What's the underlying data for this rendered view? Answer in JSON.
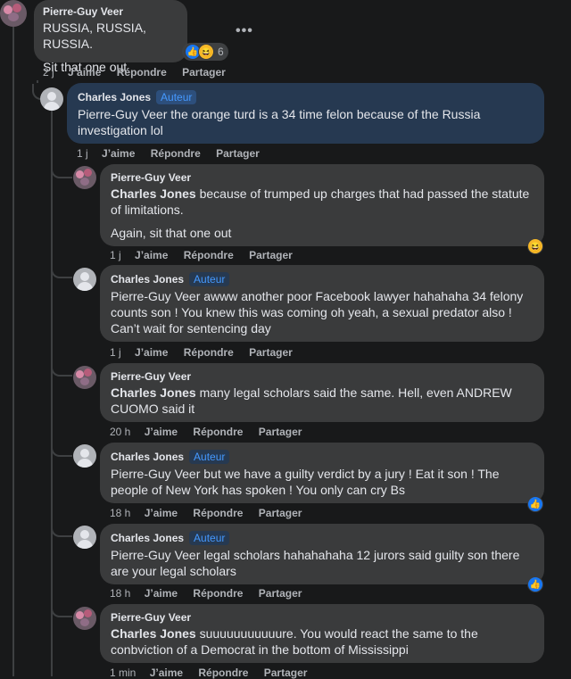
{
  "top_comment": {
    "author": "Pierre-Guy Veer",
    "line1": "RUSSIA, RUSSIA, RUSSIA.",
    "line2": "Sit that one out",
    "reaction_count": "6",
    "time": "2 j"
  },
  "actions": {
    "like": "J’aime",
    "reply": "Répondre",
    "share": "Partager"
  },
  "badge": "Auteur",
  "more_icon": "•••",
  "replies": [
    {
      "author": "Charles Jones",
      "text": "Pierre-Guy Veer the orange turd is a 34 time felon because of the Russia investigation lol",
      "time": "1 j"
    },
    {
      "author": "Pierre-Guy Veer",
      "mention": "Charles Jones",
      "text": " because of trumped up charges that had passed the statute of limitations.",
      "text2": "Again, sit that one out",
      "time": "1 j"
    },
    {
      "author": "Charles Jones",
      "text": "Pierre-Guy Veer awww another poor Facebook lawyer hahahaha 34 felony counts son ! You knew this was coming oh yeah, a sexual predator also ! Can’t wait for sentencing day",
      "time": "1 j"
    },
    {
      "author": "Pierre-Guy Veer",
      "mention": "Charles Jones",
      "text": " many legal scholars said the same. Hell, even ANDREW CUOMO said it",
      "time": "20 h"
    },
    {
      "author": "Charles Jones",
      "text": "Pierre-Guy Veer but we have a guilty verdict by a jury ! Eat it son ! The people of New York has spoken ! You only can cry Bs",
      "time": "18 h"
    },
    {
      "author": "Charles Jones",
      "text": "Pierre-Guy Veer legal scholars hahahahaha 12 jurors said guilty son there are your legal scholars",
      "time": "18 h"
    },
    {
      "author": "Pierre-Guy Veer",
      "mention": "Charles Jones",
      "text": " suuuuuuuuuuure. You would react the same to the conbviction of a Democrat in the bottom of Mississippi",
      "time": "1 min"
    }
  ]
}
